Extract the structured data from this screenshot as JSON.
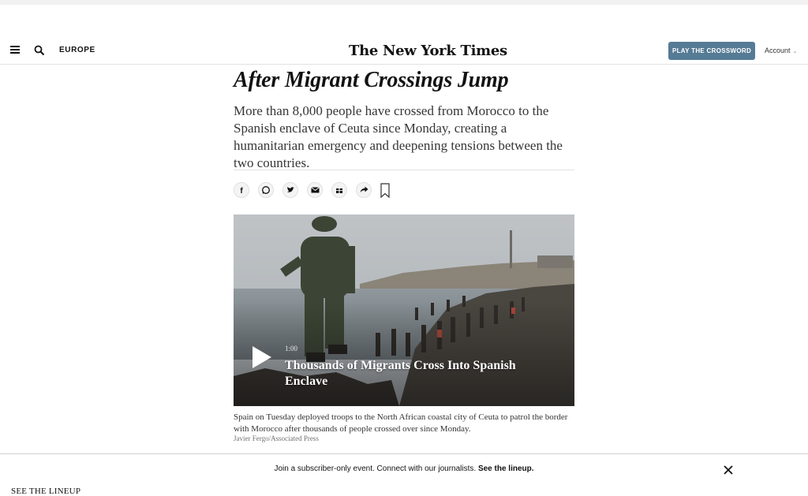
{
  "header": {
    "section": "EUROPE",
    "logo": "The New York Times",
    "crossword_button": "PLAY THE CROSSWORD",
    "account_label": "Account",
    "account_chevron": "⌄",
    "accent_color": "#567b95"
  },
  "article": {
    "headline_line2": "After Migrant Crossings Jump",
    "summary": "More than 8,000 people have crossed from Morocco to the Spanish enclave of Ceuta since Monday, creating a humanitarian emergency and deepening tensions between the two countries.",
    "share_icons": [
      "facebook-icon",
      "whatsapp-icon",
      "twitter-icon",
      "email-icon",
      "gift-icon",
      "share-icon",
      "bookmark-icon"
    ]
  },
  "video": {
    "duration": "1:00",
    "title": "Thousands of Migrants Cross Into Spanish Enclave"
  },
  "media": {
    "caption": "Spain on Tuesday deployed troops to the North African coastal city of Ceuta to patrol the border with Morocco after thousands of people crossed over since Monday.",
    "credit": "Javier Fergo/Associated Press"
  },
  "banner": {
    "text": "Join a subscriber-only event. Connect with our journalists.",
    "link": "See the lineup.",
    "cta": "SEE THE LINEUP"
  }
}
